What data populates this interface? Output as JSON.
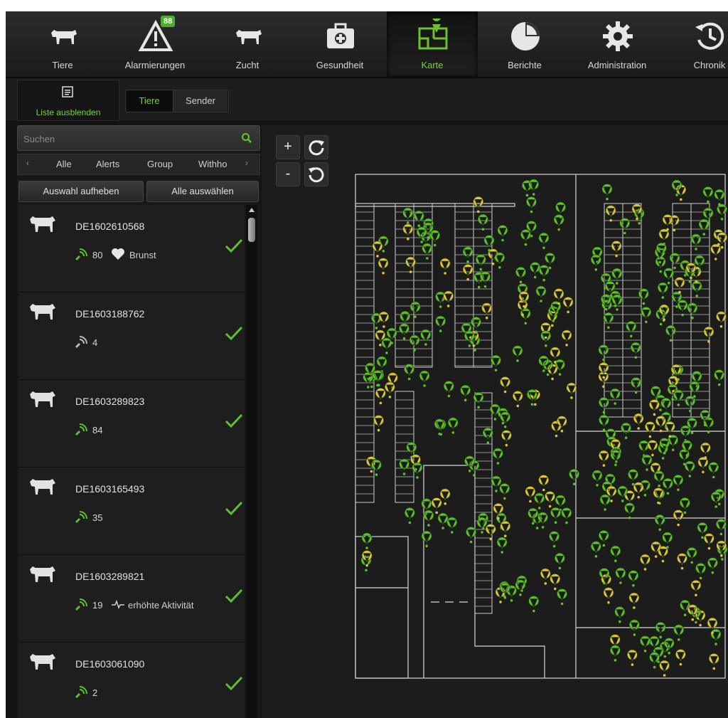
{
  "nav": {
    "items": [
      {
        "label": "Tiere",
        "icon": "cow-icon"
      },
      {
        "label": "Alarmierungen",
        "icon": "warning-icon",
        "badge": "88"
      },
      {
        "label": "Zucht",
        "icon": "cow-icon"
      },
      {
        "label": "Gesundheit",
        "icon": "medical-kit-icon"
      },
      {
        "label": "Karte",
        "icon": "map-icon",
        "active": true
      },
      {
        "label": "Berichte",
        "icon": "pie-chart-icon"
      },
      {
        "label": "Administration",
        "icon": "gear-icon"
      },
      {
        "label": "Chronik",
        "icon": "history-icon"
      }
    ]
  },
  "toolbar": {
    "hide_list_label": "Liste ausblenden",
    "segments": [
      "Tiere",
      "Sender"
    ],
    "active_segment": "Tiere"
  },
  "search": {
    "placeholder": "Suchen"
  },
  "filters": [
    "Alle",
    "Alerts",
    "Group",
    "Withho"
  ],
  "actions": {
    "deselect": "Auswahl aufheben",
    "select_all": "Alle auswählen"
  },
  "animals": [
    {
      "id": "DE1602610568",
      "signal": "80",
      "status": "Brunst",
      "status_icon": "heart-icon",
      "checked": true
    },
    {
      "id": "DE1603188762",
      "signal": "4",
      "status": "",
      "checked": true
    },
    {
      "id": "DE1603289823",
      "signal": "84",
      "status": "",
      "checked": true
    },
    {
      "id": "DE1603165493",
      "signal": "35",
      "status": "",
      "checked": true
    },
    {
      "id": "DE1603289821",
      "signal": "19",
      "status": "erhöhte Aktivität",
      "status_icon": "activity-icon",
      "checked": true
    },
    {
      "id": "DE1603061090",
      "signal": "2",
      "status": "",
      "checked": true
    }
  ],
  "map": {
    "controls": {
      "zoom_in": "+",
      "zoom_out": "-"
    },
    "colors": {
      "normal": "#5cc12a",
      "alert": "#e3c33c",
      "walls": "#d8d8d8"
    }
  },
  "colors": {
    "accent": "#7bd13a",
    "background": "#141414"
  }
}
